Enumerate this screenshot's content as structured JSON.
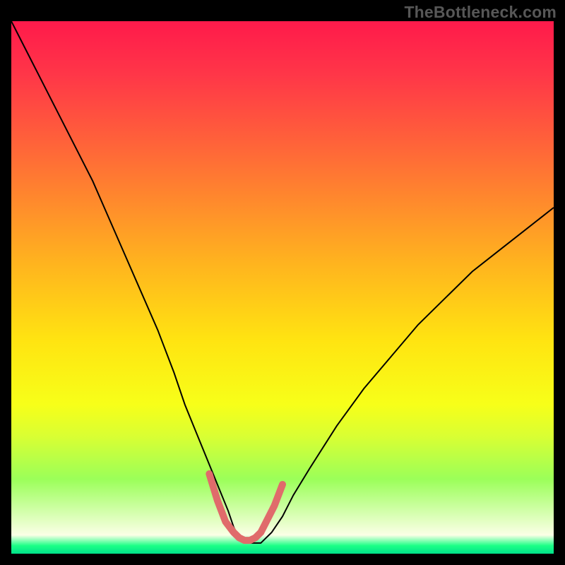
{
  "watermark": "TheBottleneck.com",
  "chart_data": {
    "type": "line",
    "title": "",
    "xlabel": "",
    "ylabel": "",
    "xlim": [
      0,
      100
    ],
    "ylim": [
      0,
      100
    ],
    "grid": false,
    "legend": false,
    "background_gradient": {
      "stops": [
        {
          "pos": 0.0,
          "color": "#ff1a4b"
        },
        {
          "pos": 0.1,
          "color": "#ff3648"
        },
        {
          "pos": 0.25,
          "color": "#ff6a37"
        },
        {
          "pos": 0.45,
          "color": "#ffb21f"
        },
        {
          "pos": 0.6,
          "color": "#ffe411"
        },
        {
          "pos": 0.72,
          "color": "#f7ff19"
        },
        {
          "pos": 0.78,
          "color": "#d9ff33"
        },
        {
          "pos": 0.86,
          "color": "#9bff59"
        },
        {
          "pos": 0.965,
          "color": "#fbffe6"
        },
        {
          "pos": 0.985,
          "color": "#1bff86"
        },
        {
          "pos": 1.0,
          "color": "#00e18a"
        }
      ]
    },
    "series": [
      {
        "name": "bottleneck-curve",
        "color": "#000000",
        "width": 2,
        "x": [
          0,
          3,
          6,
          9,
          12,
          15,
          18,
          21,
          24,
          27,
          30,
          32,
          34,
          36,
          38,
          40,
          41,
          42,
          43,
          44,
          46,
          48,
          50,
          52,
          55,
          60,
          65,
          70,
          75,
          80,
          85,
          90,
          95,
          100
        ],
        "y": [
          100,
          94,
          88,
          82,
          76,
          70,
          63,
          56,
          49,
          42,
          34,
          28,
          23,
          18,
          13,
          8,
          5,
          3,
          2,
          2,
          2,
          4,
          7,
          11,
          16,
          24,
          31,
          37,
          43,
          48,
          53,
          57,
          61,
          65
        ]
      },
      {
        "name": "trough-highlight",
        "color": "#e06b6b",
        "width": 10,
        "linecap": "round",
        "x": [
          36.5,
          38,
          39.5,
          41,
          42,
          43,
          44,
          45,
          46,
          47,
          48.5,
          50
        ],
        "y": [
          15,
          10,
          6,
          4,
          3,
          2.5,
          2.5,
          3,
          4,
          6,
          9,
          13
        ]
      }
    ]
  }
}
